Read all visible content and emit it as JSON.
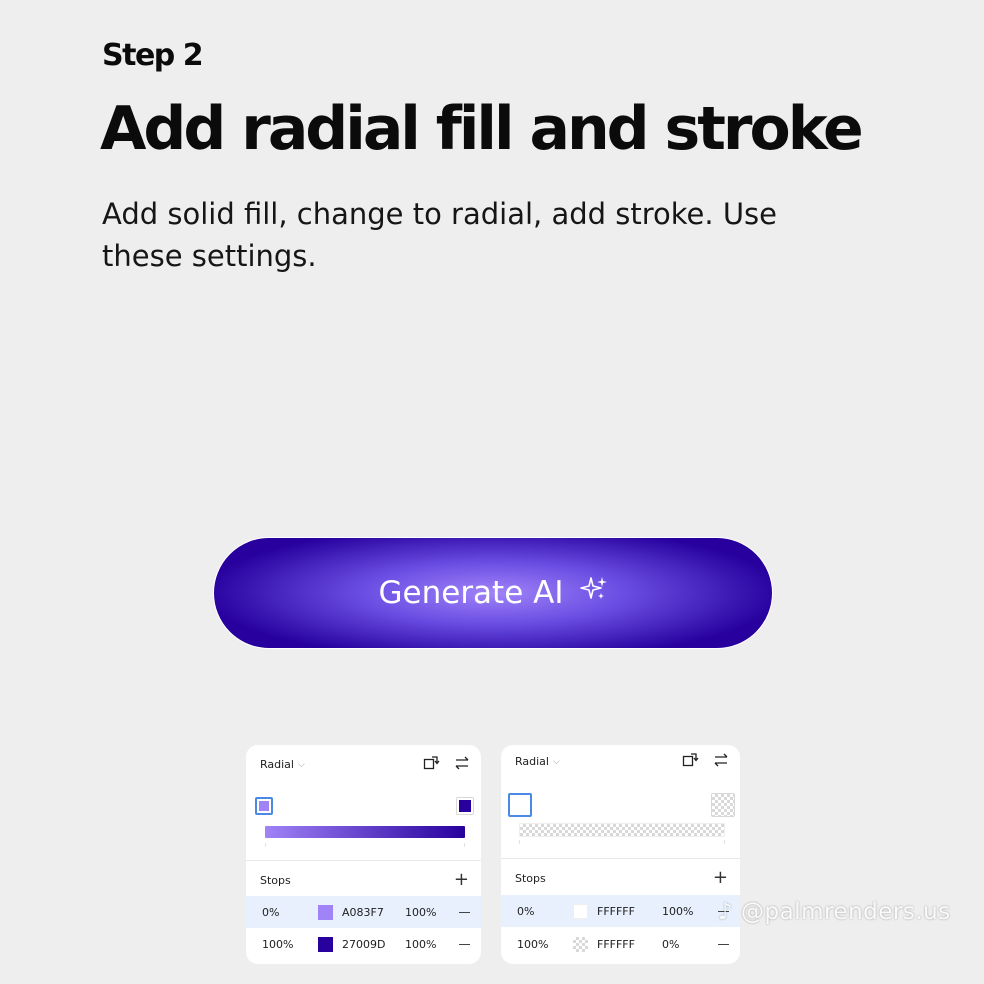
{
  "header": {
    "step": "Step 2",
    "title": "Add radial fill and stroke",
    "description": "Add solid fill, change to radial, add stroke. Use these settings."
  },
  "cta": {
    "label": "Generate AI",
    "icon": "sparkles-icon"
  },
  "colors": {
    "fill_start": "#A083F7",
    "fill_end": "#27009D",
    "stroke": "#FFFFFF",
    "background": "#EFEEEE"
  },
  "fill_panel": {
    "type": "Radial",
    "stops_label": "Stops",
    "stops": [
      {
        "position": "0%",
        "hex": "A083F7",
        "opacity": "100%",
        "color": "#A083F7"
      },
      {
        "position": "100%",
        "hex": "27009D",
        "opacity": "100%",
        "color": "#27009D"
      }
    ]
  },
  "stroke_panel": {
    "type": "Radial",
    "stops_label": "Stops",
    "stops": [
      {
        "position": "0%",
        "hex": "FFFFFF",
        "opacity": "100%",
        "color": "#FFFFFF"
      },
      {
        "position": "100%",
        "hex": "FFFFFF",
        "opacity": "0%",
        "color": "#FFFFFF"
      }
    ]
  },
  "watermark": "@palmrenders.us"
}
